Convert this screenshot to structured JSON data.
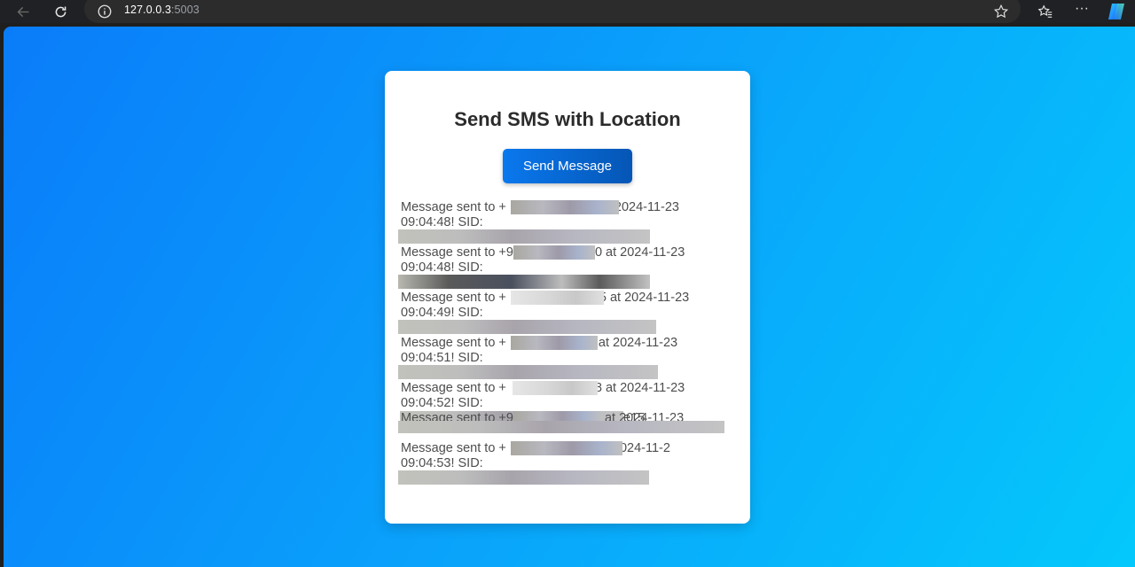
{
  "browser": {
    "url_host": "127.0.0.3",
    "url_port": ":5003"
  },
  "page": {
    "title": "Send SMS with Location",
    "send_button_label": "Send Message"
  },
  "messages": [
    {
      "prefix": "Message sent to +",
      "suffix": "2024-11-23",
      "time": "09:04:48! SID:"
    },
    {
      "prefix": "Message sent to +9",
      "suffix": "0 at 2024-11-23",
      "time": "09:04:48! SID:"
    },
    {
      "prefix": "Message sent to +",
      "suffix": "5 at 2024-11-23",
      "time": "09:04:49! SID:"
    },
    {
      "prefix": "Message sent to +",
      "suffix": "at 2024-11-23",
      "time": "09:04:51! SID:"
    },
    {
      "prefix": "Message sent to +",
      "suffix": "8 at 2024-11-23",
      "time": "09:04:52! SID:",
      "extra": "e15"
    },
    {
      "prefix": "Message sent to +9",
      "suffix": "at 2024-11-23",
      "time": ""
    },
    {
      "prefix": "Message sent to +",
      "suffix": "2024-11-2",
      "time": "09:04:53! SID:"
    }
  ]
}
